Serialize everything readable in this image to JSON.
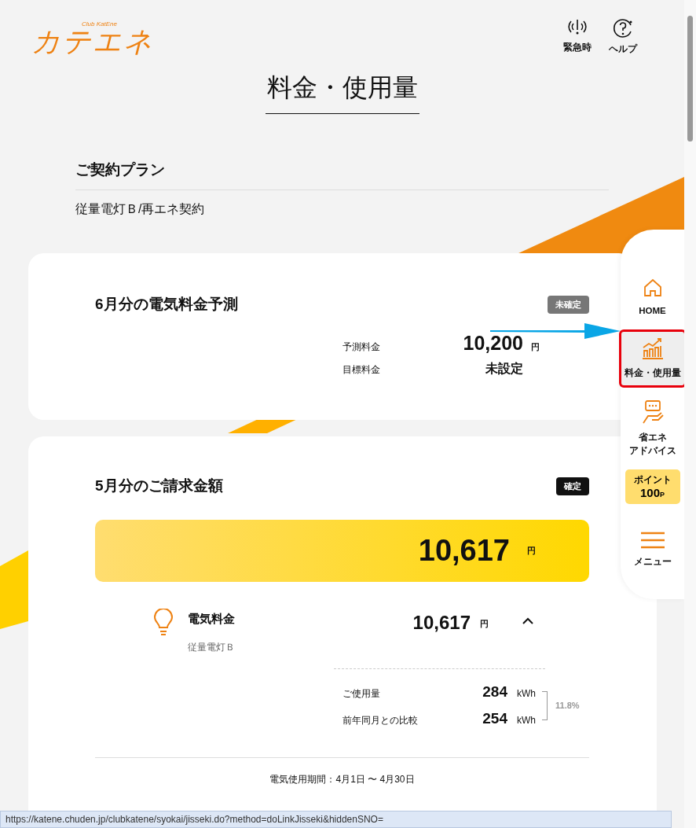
{
  "header": {
    "logo": "カテエネ",
    "logo_sub": "Club KatEne",
    "actions": [
      {
        "label": "緊急時",
        "kind": "emergency"
      },
      {
        "label": "ヘルプ",
        "kind": "help"
      }
    ]
  },
  "page_title": "料金・使用量",
  "plan": {
    "heading": "ご契約プラン",
    "value": "従量電灯Ｂ/再エネ契約"
  },
  "forecast": {
    "title": "6月分の電気料金予測",
    "badge": "未確定",
    "confirmed": false,
    "rows": [
      {
        "label": "予測料金",
        "value": "10,200",
        "unit": "円"
      },
      {
        "label": "目標料金",
        "value": "未設定"
      }
    ]
  },
  "bill": {
    "title": "5月分のご請求金額",
    "badge": "確定",
    "confirmed": true,
    "total": "10,617",
    "total_unit": "円",
    "item": {
      "name": "電気料金",
      "plan": "従量電灯Ｂ",
      "amount": "10,617",
      "unit": "円",
      "expanded": true
    },
    "usage": [
      {
        "label": "ご使用量",
        "value": "284",
        "unit": "kWh"
      },
      {
        "label": "前年同月との比較",
        "value": "254",
        "unit": "kWh"
      }
    ],
    "change": "11.8%",
    "period": "電気使用期間：4月1日 〜 4月30日"
  },
  "side_nav": [
    {
      "kind": "home",
      "label": "HOME",
      "selected": false
    },
    {
      "kind": "chart",
      "label": "料金・使用量",
      "selected": true
    },
    {
      "kind": "advice",
      "label_lines": [
        "省エネ",
        "アドバイス"
      ],
      "selected": false
    },
    {
      "kind": "points",
      "label": "ポイント",
      "value": "100",
      "unit": "P",
      "selected": false
    },
    {
      "kind": "menu",
      "label": "メニュー",
      "selected": false
    }
  ],
  "status_bar": {
    "url": "https://katene.chuden.jp/clubkatene/syokai/jisseki.do?method=doLinkJisseki&hiddenSNO="
  }
}
